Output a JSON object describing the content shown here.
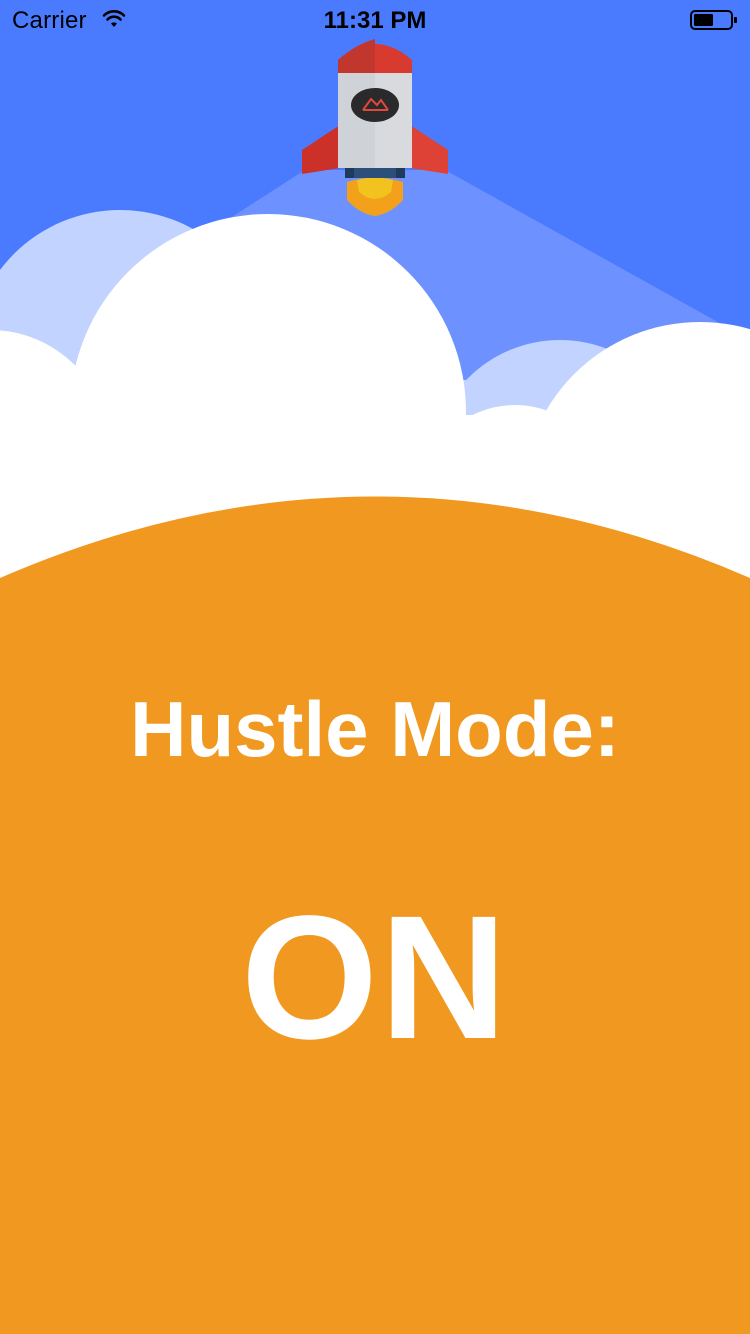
{
  "status_bar": {
    "carrier": "Carrier",
    "time": "11:31 PM"
  },
  "main": {
    "hustle_label": "Hustle Mode:",
    "state_label": "ON"
  },
  "icons": [
    "wifi-icon",
    "battery-icon",
    "rocket-icon",
    "mountain-logo-icon"
  ],
  "colors": {
    "sky": "#4a7bff",
    "cloud_back": "#c2d3ff",
    "cloud_front": "#ffffff",
    "beam": "#6d92ff",
    "ground": "#f0981f",
    "rocket_body": "#d8dadd",
    "rocket_red": "#d93a30",
    "flame_outer": "#f3a11b",
    "flame_inner": "#f2c31e"
  }
}
